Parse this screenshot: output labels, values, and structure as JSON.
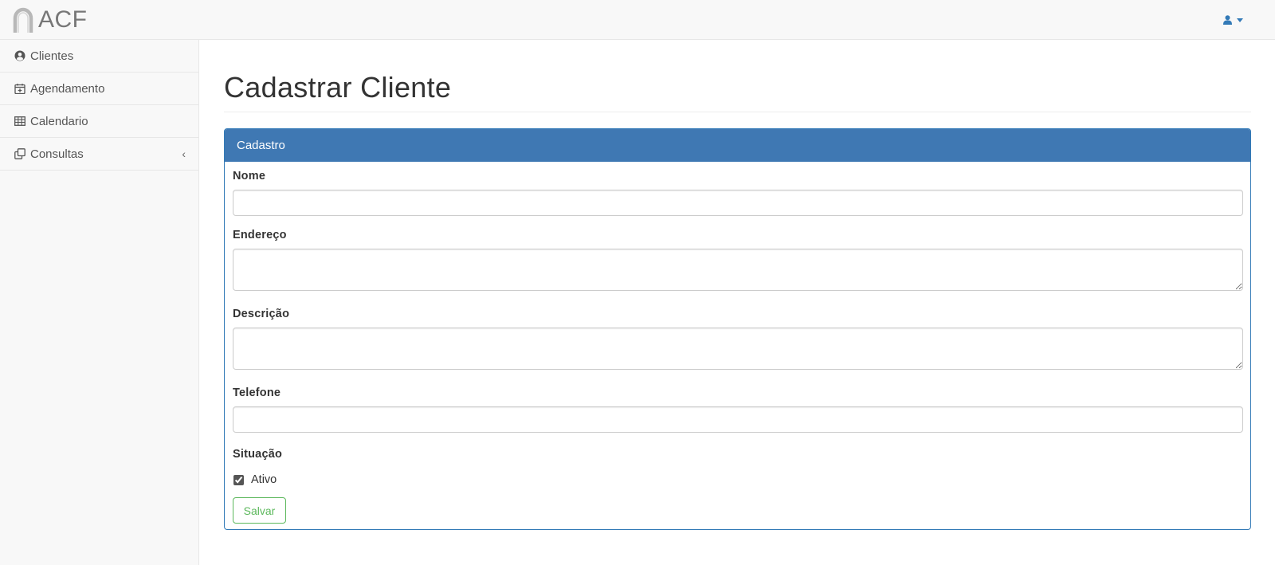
{
  "navbar": {
    "brand": "ACF",
    "logo_icon": "horseshoe-icon",
    "user_icon": "user-icon"
  },
  "sidebar": {
    "items": [
      {
        "label": "Clientes",
        "icon": "user-circle-icon",
        "has_submenu": false
      },
      {
        "label": "Agendamento",
        "icon": "calendar-plus-icon",
        "has_submenu": false
      },
      {
        "label": "Calendario",
        "icon": "table-icon",
        "has_submenu": false
      },
      {
        "label": "Consultas",
        "icon": "clone-icon",
        "has_submenu": true,
        "chevron": "‹"
      }
    ]
  },
  "page": {
    "title": "Cadastrar Cliente"
  },
  "panel": {
    "heading": "Cadastro",
    "fields": {
      "nome": {
        "label": "Nome",
        "value": ""
      },
      "endereco": {
        "label": "Endereço",
        "value": ""
      },
      "descricao": {
        "label": "Descrição",
        "value": ""
      },
      "telefone": {
        "label": "Telefone",
        "value": ""
      }
    },
    "situacao": {
      "label": "Situação",
      "checkbox_label": "Ativo",
      "checked": true
    },
    "save_label": "Salvar"
  },
  "colors": {
    "primary": "#337ab7",
    "panel_heading": "#3f78b3",
    "success": "#5cb85c",
    "navbar_bg": "#f8f8f8"
  }
}
